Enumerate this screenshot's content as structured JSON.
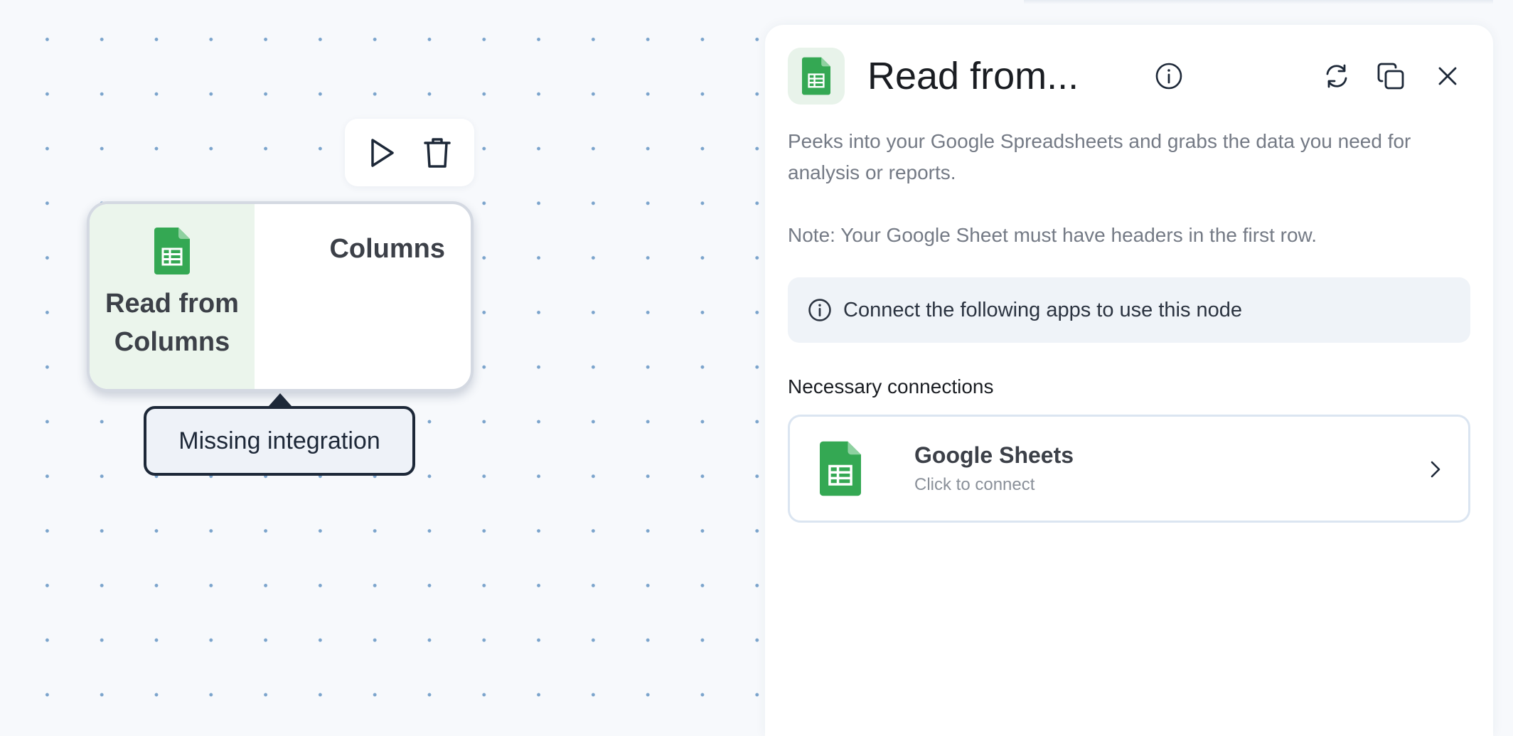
{
  "node": {
    "title": "Read from Columns",
    "columns_label": "Columns",
    "tooltip": "Missing integration"
  },
  "toolbar": {
    "run_icon": "play-icon",
    "delete_icon": "trash-icon"
  },
  "panel": {
    "title": "Read from...",
    "description": "Peeks into your Google Spreadsheets and grabs the data you need for analysis or reports.",
    "note": "Note: Your Google Sheet must have headers in the first row.",
    "banner": "Connect the following apps to use this node",
    "section_label": "Necessary connections",
    "connection": {
      "name": "Google Sheets",
      "subtitle": "Click to connect"
    },
    "header_icons": [
      "info-icon",
      "refresh-icon",
      "duplicate-icon",
      "close-icon"
    ]
  },
  "colors": {
    "sheets_green": "#34a853",
    "node_left_bg": "#ebf5ec",
    "tooltip_border": "#1d2838"
  }
}
